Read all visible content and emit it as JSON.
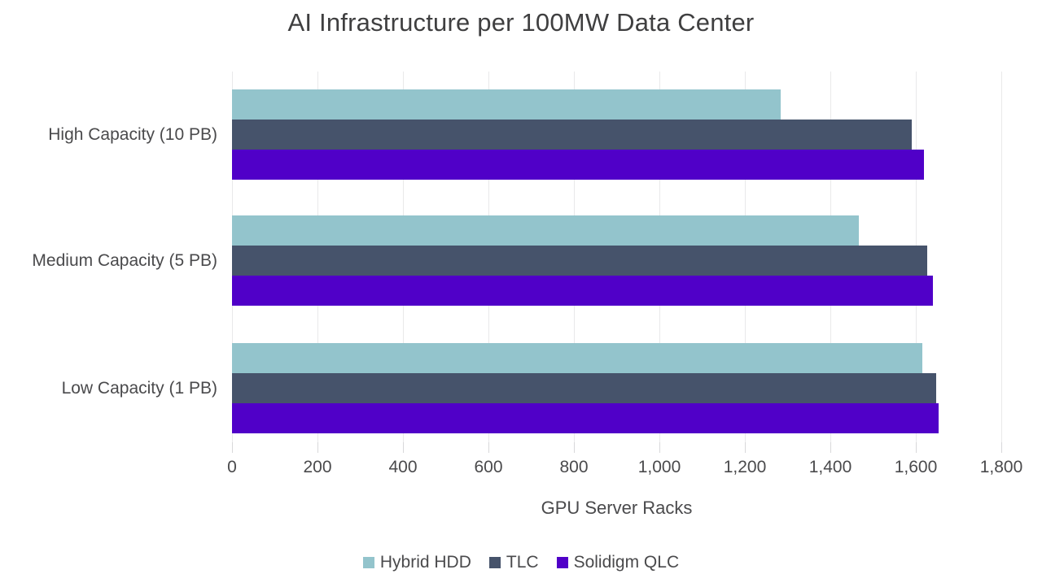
{
  "chart_data": {
    "type": "bar",
    "orientation": "horizontal",
    "title": "AI Infrastructure per 100MW Data Center",
    "xlabel": "GPU Server Racks",
    "ylabel": "",
    "categories": [
      "High Capacity (10 PB)",
      "Medium Capacity (5 PB)",
      "Low Capacity (1 PB)"
    ],
    "series": [
      {
        "name": "Hybrid HDD",
        "color": "#93c4cc",
        "values": [
          1284,
          1466,
          1615
        ]
      },
      {
        "name": "TLC",
        "color": "#46536b",
        "values": [
          1590,
          1627,
          1648
        ]
      },
      {
        "name": "Solidigm QLC",
        "color": "#5000c8",
        "values": [
          1619,
          1640,
          1653
        ]
      }
    ],
    "xlim": [
      0,
      1800
    ],
    "xticks": [
      0,
      200,
      400,
      600,
      800,
      1000,
      1200,
      1400,
      1600,
      1800
    ],
    "xtick_labels": [
      "0",
      "200",
      "400",
      "600",
      "800",
      "1,000",
      "1,200",
      "1,400",
      "1,600",
      "1,800"
    ],
    "grid": true,
    "grid_axis": "x",
    "legend_position": "bottom"
  },
  "style": {
    "background": "#ffffff",
    "title_color": "#3f3f40",
    "text_color": "#4a4a4c",
    "gridline_color": "#e9e9ea"
  }
}
